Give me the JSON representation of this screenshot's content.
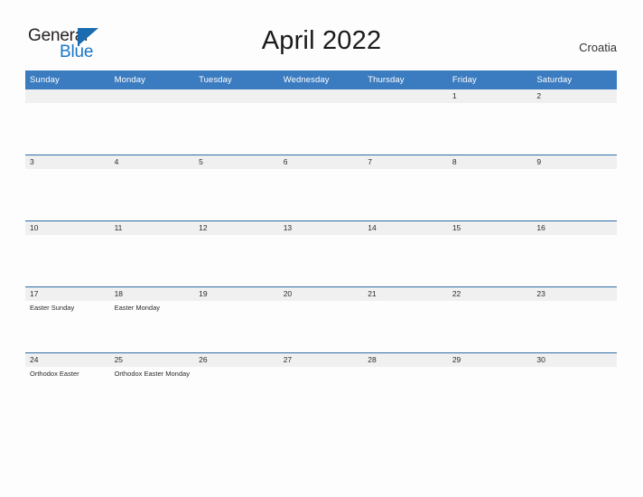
{
  "brand": {
    "name_part1": "General",
    "name_part2": "Blue",
    "flag_icon": "blue-flag-triangle",
    "accent_color": "#1a76c6"
  },
  "header": {
    "title": "April 2022",
    "country": "Croatia"
  },
  "calendar": {
    "month": "April",
    "year": "2022",
    "header_bg_color": "#3b7cc0",
    "datebar_bg_color": "#f0f0f0",
    "weekday_headers": [
      "Sunday",
      "Monday",
      "Tuesday",
      "Wednesday",
      "Thursday",
      "Friday",
      "Saturday"
    ],
    "weeks": [
      [
        {
          "date": "",
          "events": []
        },
        {
          "date": "",
          "events": []
        },
        {
          "date": "",
          "events": []
        },
        {
          "date": "",
          "events": []
        },
        {
          "date": "",
          "events": []
        },
        {
          "date": "1",
          "events": []
        },
        {
          "date": "2",
          "events": []
        }
      ],
      [
        {
          "date": "3",
          "events": []
        },
        {
          "date": "4",
          "events": []
        },
        {
          "date": "5",
          "events": []
        },
        {
          "date": "6",
          "events": []
        },
        {
          "date": "7",
          "events": []
        },
        {
          "date": "8",
          "events": []
        },
        {
          "date": "9",
          "events": []
        }
      ],
      [
        {
          "date": "10",
          "events": []
        },
        {
          "date": "11",
          "events": []
        },
        {
          "date": "12",
          "events": []
        },
        {
          "date": "13",
          "events": []
        },
        {
          "date": "14",
          "events": []
        },
        {
          "date": "15",
          "events": []
        },
        {
          "date": "16",
          "events": []
        }
      ],
      [
        {
          "date": "17",
          "events": [
            "Easter Sunday"
          ]
        },
        {
          "date": "18",
          "events": [
            "Easter Monday"
          ]
        },
        {
          "date": "19",
          "events": []
        },
        {
          "date": "20",
          "events": []
        },
        {
          "date": "21",
          "events": []
        },
        {
          "date": "22",
          "events": []
        },
        {
          "date": "23",
          "events": []
        }
      ],
      [
        {
          "date": "24",
          "events": [
            "Orthodox Easter"
          ]
        },
        {
          "date": "25",
          "events": [
            "Orthodox Easter Monday"
          ]
        },
        {
          "date": "26",
          "events": []
        },
        {
          "date": "27",
          "events": []
        },
        {
          "date": "28",
          "events": []
        },
        {
          "date": "29",
          "events": []
        },
        {
          "date": "30",
          "events": []
        }
      ]
    ]
  }
}
